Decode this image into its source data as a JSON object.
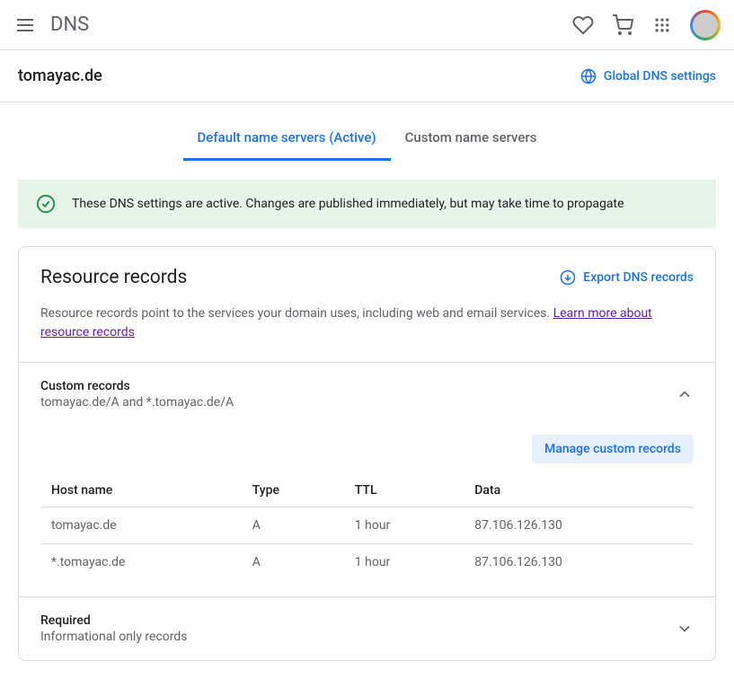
{
  "header": {
    "app_title": "DNS"
  },
  "subheader": {
    "domain": "tomayac.de",
    "global_settings": "Global DNS settings"
  },
  "tabs": {
    "default": "Default name servers (Active)",
    "custom": "Custom name servers"
  },
  "banner": {
    "message": "These DNS settings are active. Changes are published immediately, but may take time to propagate"
  },
  "resource_records": {
    "title": "Resource records",
    "export": "Export DNS records",
    "description_prefix": "Resource records point to the services your domain uses, including web and email services. ",
    "description_link": "Learn more about resource records"
  },
  "custom_section": {
    "title": "Custom records",
    "subtitle": "tomayac.de/A and *.tomayac.de/A",
    "manage": "Manage custom records",
    "columns": {
      "host": "Host name",
      "type": "Type",
      "ttl": "TTL",
      "data": "Data"
    },
    "rows": [
      {
        "host": "tomayac.de",
        "type": "A",
        "ttl": "1 hour",
        "data": "87.106.126.130"
      },
      {
        "host": "*.tomayac.de",
        "type": "A",
        "ttl": "1 hour",
        "data": "87.106.126.130"
      }
    ]
  },
  "required_section": {
    "title": "Required",
    "subtitle": "Informational only records"
  }
}
